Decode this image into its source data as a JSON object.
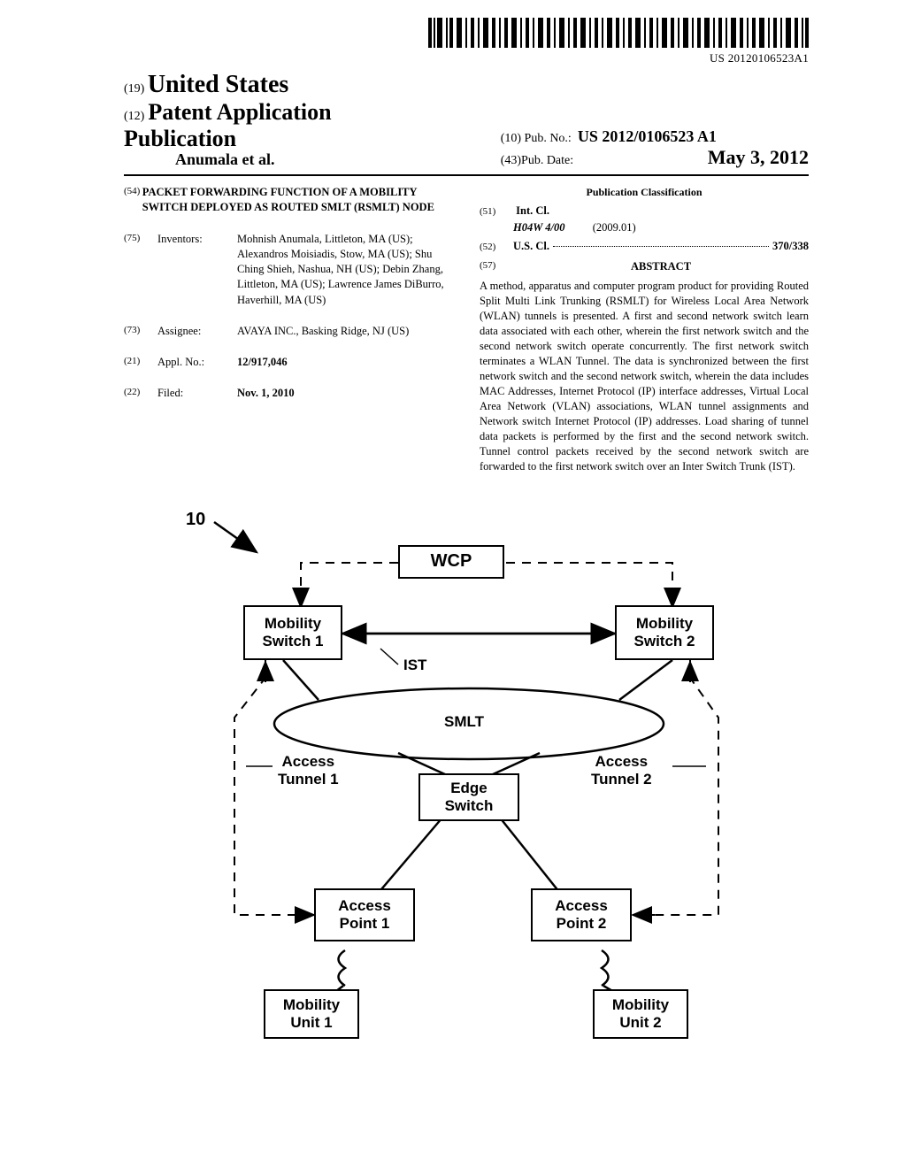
{
  "barcode_sub": "US 20120106523A1",
  "header": {
    "code19": "(19)",
    "country": "United States",
    "code12": "(12)",
    "pub_line": "Patent Application Publication",
    "authors_line": "Anumala et al.",
    "code10": "(10)",
    "pubno_label": "Pub. No.:",
    "pubno_value": "US 2012/0106523 A1",
    "code43": "(43)",
    "pubdate_label": "Pub. Date:",
    "pubdate_value": "May 3, 2012"
  },
  "left": {
    "code54": "(54)",
    "title": "PACKET FORWARDING FUNCTION OF A MOBILITY SWITCH DEPLOYED AS ROUTED SMLT (RSMLT) NODE",
    "code75": "(75)",
    "inventors_label": "Inventors:",
    "inventors_value": "Mohnish Anumala, Littleton, MA (US); Alexandros Moisiadis, Stow, MA (US); Shu Ching Shieh, Nashua, NH (US); Debin Zhang, Littleton, MA (US); Lawrence James DiBurro, Haverhill, MA (US)",
    "code73": "(73)",
    "assignee_label": "Assignee:",
    "assignee_value": "AVAYA INC., Basking Ridge, NJ (US)",
    "code21": "(21)",
    "applno_label": "Appl. No.:",
    "applno_value": "12/917,046",
    "code22": "(22)",
    "filed_label": "Filed:",
    "filed_value": "Nov. 1, 2010"
  },
  "right": {
    "class_heading": "Publication Classification",
    "code51": "(51)",
    "intcl_label": "Int. Cl.",
    "intcl_code": "H04W 4/00",
    "intcl_year": "(2009.01)",
    "code52": "(52)",
    "uscl_label": "U.S. Cl.",
    "uscl_value": "370/338",
    "code57": "(57)",
    "abstract_label": "ABSTRACT",
    "abstract_body": "A method, apparatus and computer program product for providing Routed Split Multi Link Trunking (RSMLT) for Wireless Local Area Network (WLAN) tunnels is presented. A first and second network switch learn data associated with each other, wherein the first network switch and the second network switch operate concurrently. The first network switch terminates a WLAN Tunnel. The data is synchronized between the first network switch and the second network switch, wherein the data includes MAC Addresses, Internet Protocol (IP) interface addresses, Virtual Local Area Network (VLAN) associations, WLAN tunnel assignments and Network switch Internet Protocol (IP) addresses. Load sharing of tunnel data packets is performed by the first and the second network switch. Tunnel control packets received by the second network switch are forwarded to the first network switch over an Inter Switch Trunk (IST)."
  },
  "figure": {
    "ref": "10",
    "wcp": "WCP",
    "ms1": "Mobility\nSwitch 1",
    "ms2": "Mobility\nSwitch 2",
    "ist": "IST",
    "smlt": "SMLT",
    "edge": "Edge\nSwitch",
    "at1": "Access\nTunnel 1",
    "at2": "Access\nTunnel 2",
    "ap1": "Access\nPoint 1",
    "ap2": "Access\nPoint 2",
    "mu1": "Mobility\nUnit 1",
    "mu2": "Mobility\nUnit 2"
  }
}
